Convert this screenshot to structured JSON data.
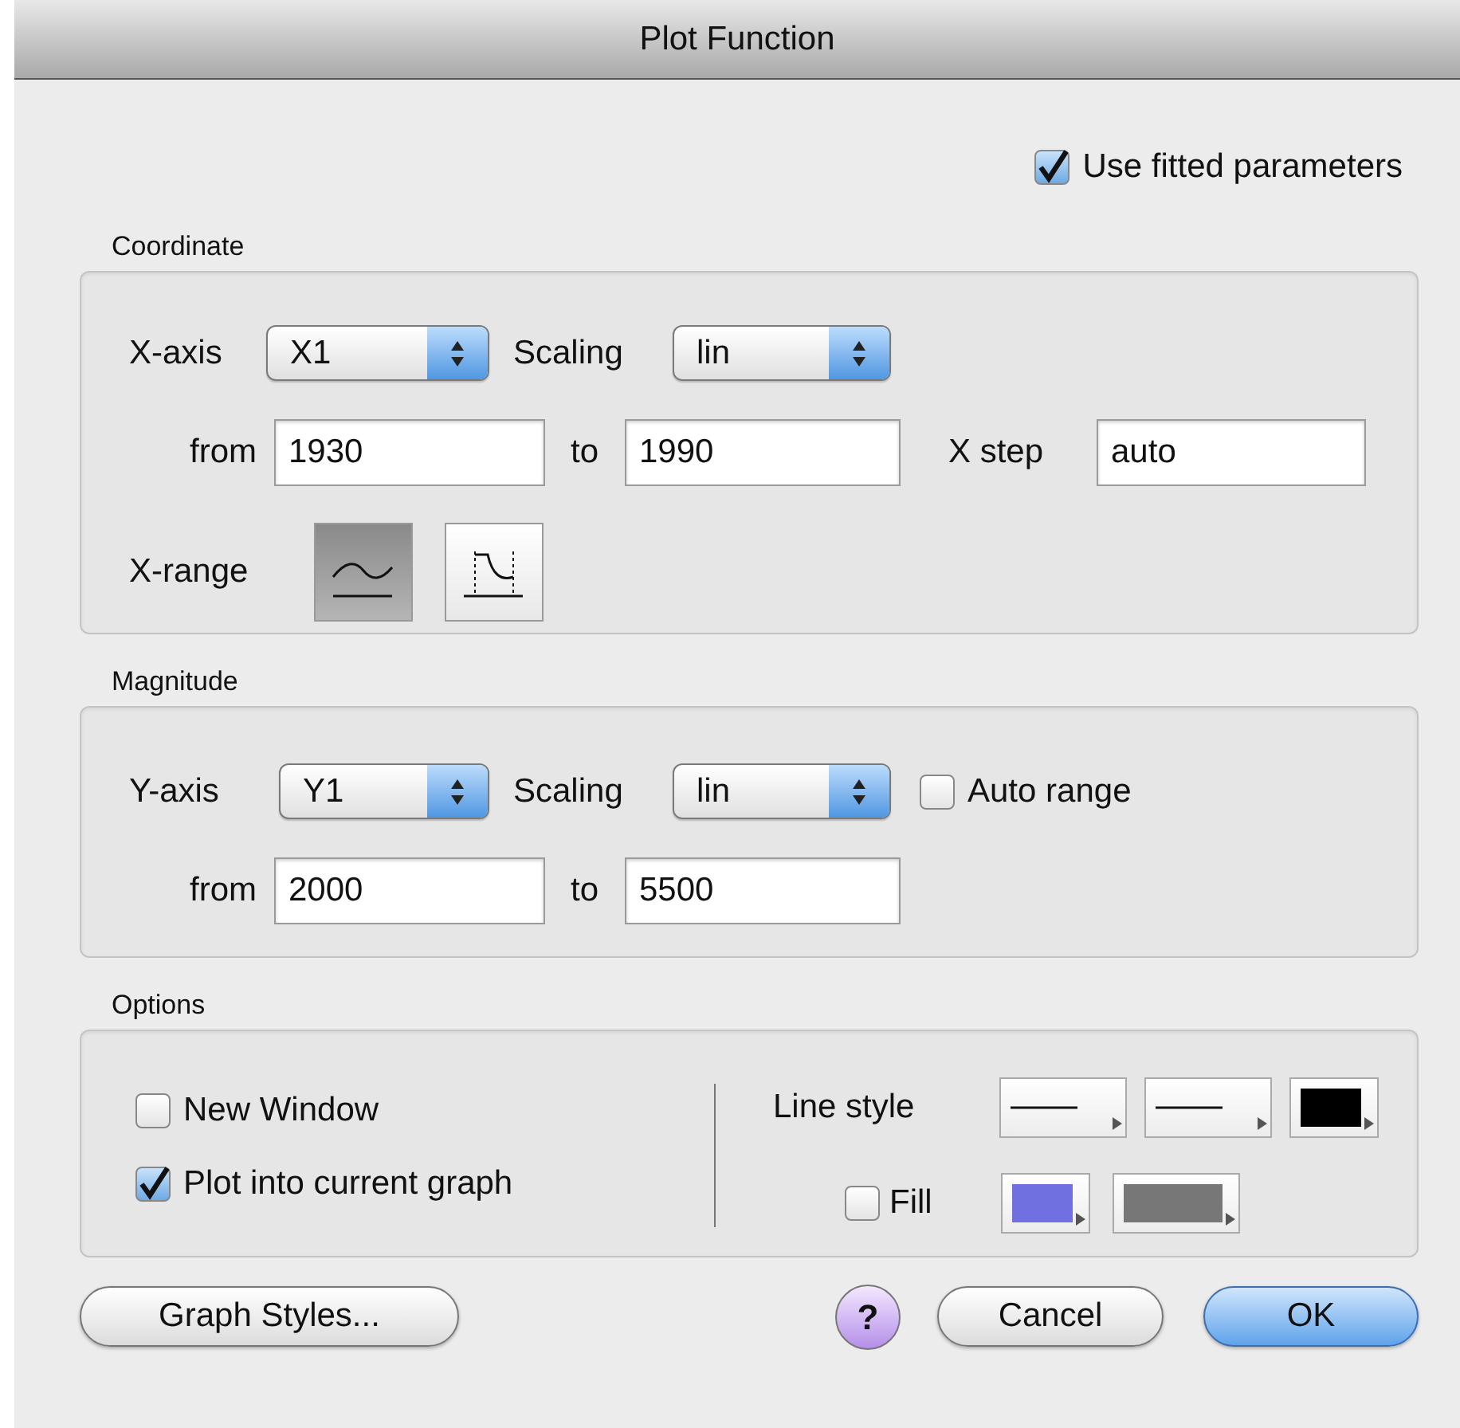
{
  "window": {
    "title": "Plot Function"
  },
  "use_fitted": {
    "label": "Use fitted parameters",
    "checked": true
  },
  "coordinate": {
    "title": "Coordinate",
    "axis": {
      "label": "X-axis",
      "value": "X1"
    },
    "scaling": {
      "label": "Scaling",
      "value": "lin"
    },
    "from": {
      "label": "from",
      "value": "1930"
    },
    "to": {
      "label": "to",
      "value": "1990"
    },
    "step": {
      "label": "X step",
      "value": "auto"
    },
    "range": {
      "label": "X-range",
      "modes": [
        {
          "kind": "curve",
          "selected": true
        },
        {
          "kind": "clipped",
          "selected": false
        }
      ]
    }
  },
  "magnitude": {
    "title": "Magnitude",
    "axis": {
      "label": "Y-axis",
      "value": "Y1"
    },
    "scaling": {
      "label": "Scaling",
      "value": "lin"
    },
    "auto_range": {
      "label": "Auto range",
      "checked": false
    },
    "from": {
      "label": "from",
      "value": "2000"
    },
    "to": {
      "label": "to",
      "value": "5500"
    }
  },
  "options": {
    "title": "Options",
    "checkboxes": [
      {
        "label": "New Window",
        "checked": false
      },
      {
        "label": "Plot into current graph",
        "checked": true
      }
    ],
    "line_style": {
      "label": "Line style",
      "swatches": [
        {
          "kind": "line"
        },
        {
          "kind": "line"
        },
        {
          "kind": "color",
          "color": "#000000"
        }
      ]
    },
    "fill": {
      "label": "Fill",
      "checked": false,
      "swatches": [
        {
          "kind": "color",
          "color": "#7070e0"
        },
        {
          "kind": "color",
          "color": "#777777"
        }
      ]
    }
  },
  "buttons": [
    {
      "label": "Graph Styles...",
      "kind": "normal"
    },
    {
      "label": "?",
      "kind": "help"
    },
    {
      "label": "Cancel",
      "kind": "normal"
    },
    {
      "label": "OK",
      "kind": "default"
    }
  ]
}
